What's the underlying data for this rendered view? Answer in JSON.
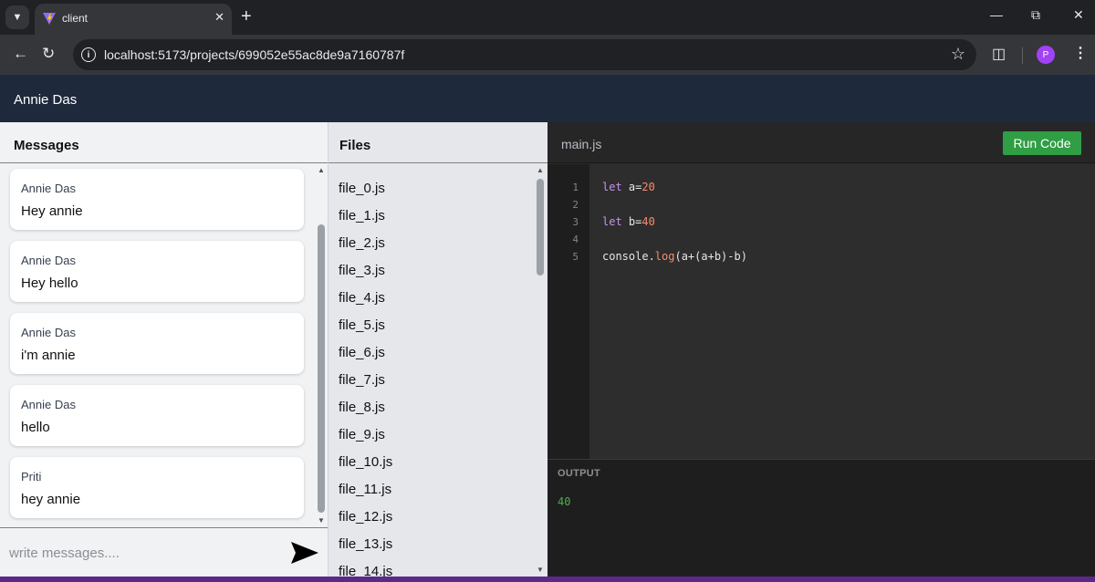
{
  "browser": {
    "tab_title": "client",
    "url": "localhost:5173/projects/699052e55ac8de9a7160787f",
    "avatar_letter": "P",
    "accent_color": "#a142f4"
  },
  "header": {
    "user_name": "Annie Das"
  },
  "messages": {
    "title": "Messages",
    "items": [
      {
        "author": "Annie Das",
        "text": "Hey annie"
      },
      {
        "author": "Annie Das",
        "text": "Hey hello"
      },
      {
        "author": "Annie Das",
        "text": "i'm annie"
      },
      {
        "author": "Annie Das",
        "text": "hello"
      },
      {
        "author": "Priti",
        "text": "hey annie"
      }
    ],
    "input_placeholder": "write messages....",
    "input_value": ""
  },
  "files": {
    "title": "Files",
    "items": [
      "file_0.js",
      "file_1.js",
      "file_2.js",
      "file_3.js",
      "file_4.js",
      "file_5.js",
      "file_6.js",
      "file_7.js",
      "file_8.js",
      "file_9.js",
      "file_10.js",
      "file_11.js",
      "file_12.js",
      "file_13.js",
      "file_14.js"
    ]
  },
  "editor": {
    "filename": "main.js",
    "run_label": "Run Code",
    "run_color": "#2f9e44",
    "lines": [
      {
        "n": "1",
        "tokens": [
          {
            "t": "let",
            "c": "kw"
          },
          {
            "t": " a=",
            "c": ""
          },
          {
            "t": "20",
            "c": "num"
          }
        ]
      },
      {
        "n": "2",
        "tokens": []
      },
      {
        "n": "3",
        "tokens": [
          {
            "t": "let",
            "c": "kw"
          },
          {
            "t": " b=",
            "c": ""
          },
          {
            "t": "40",
            "c": "num"
          }
        ]
      },
      {
        "n": "4",
        "tokens": []
      },
      {
        "n": "5",
        "tokens": [
          {
            "t": "console.",
            "c": ""
          },
          {
            "t": "log",
            "c": "fn"
          },
          {
            "t": "(a+(a+b)-b)",
            "c": ""
          }
        ]
      }
    ]
  },
  "output": {
    "label": "OUTPUT",
    "text": "40",
    "text_color": "#4caf50"
  }
}
